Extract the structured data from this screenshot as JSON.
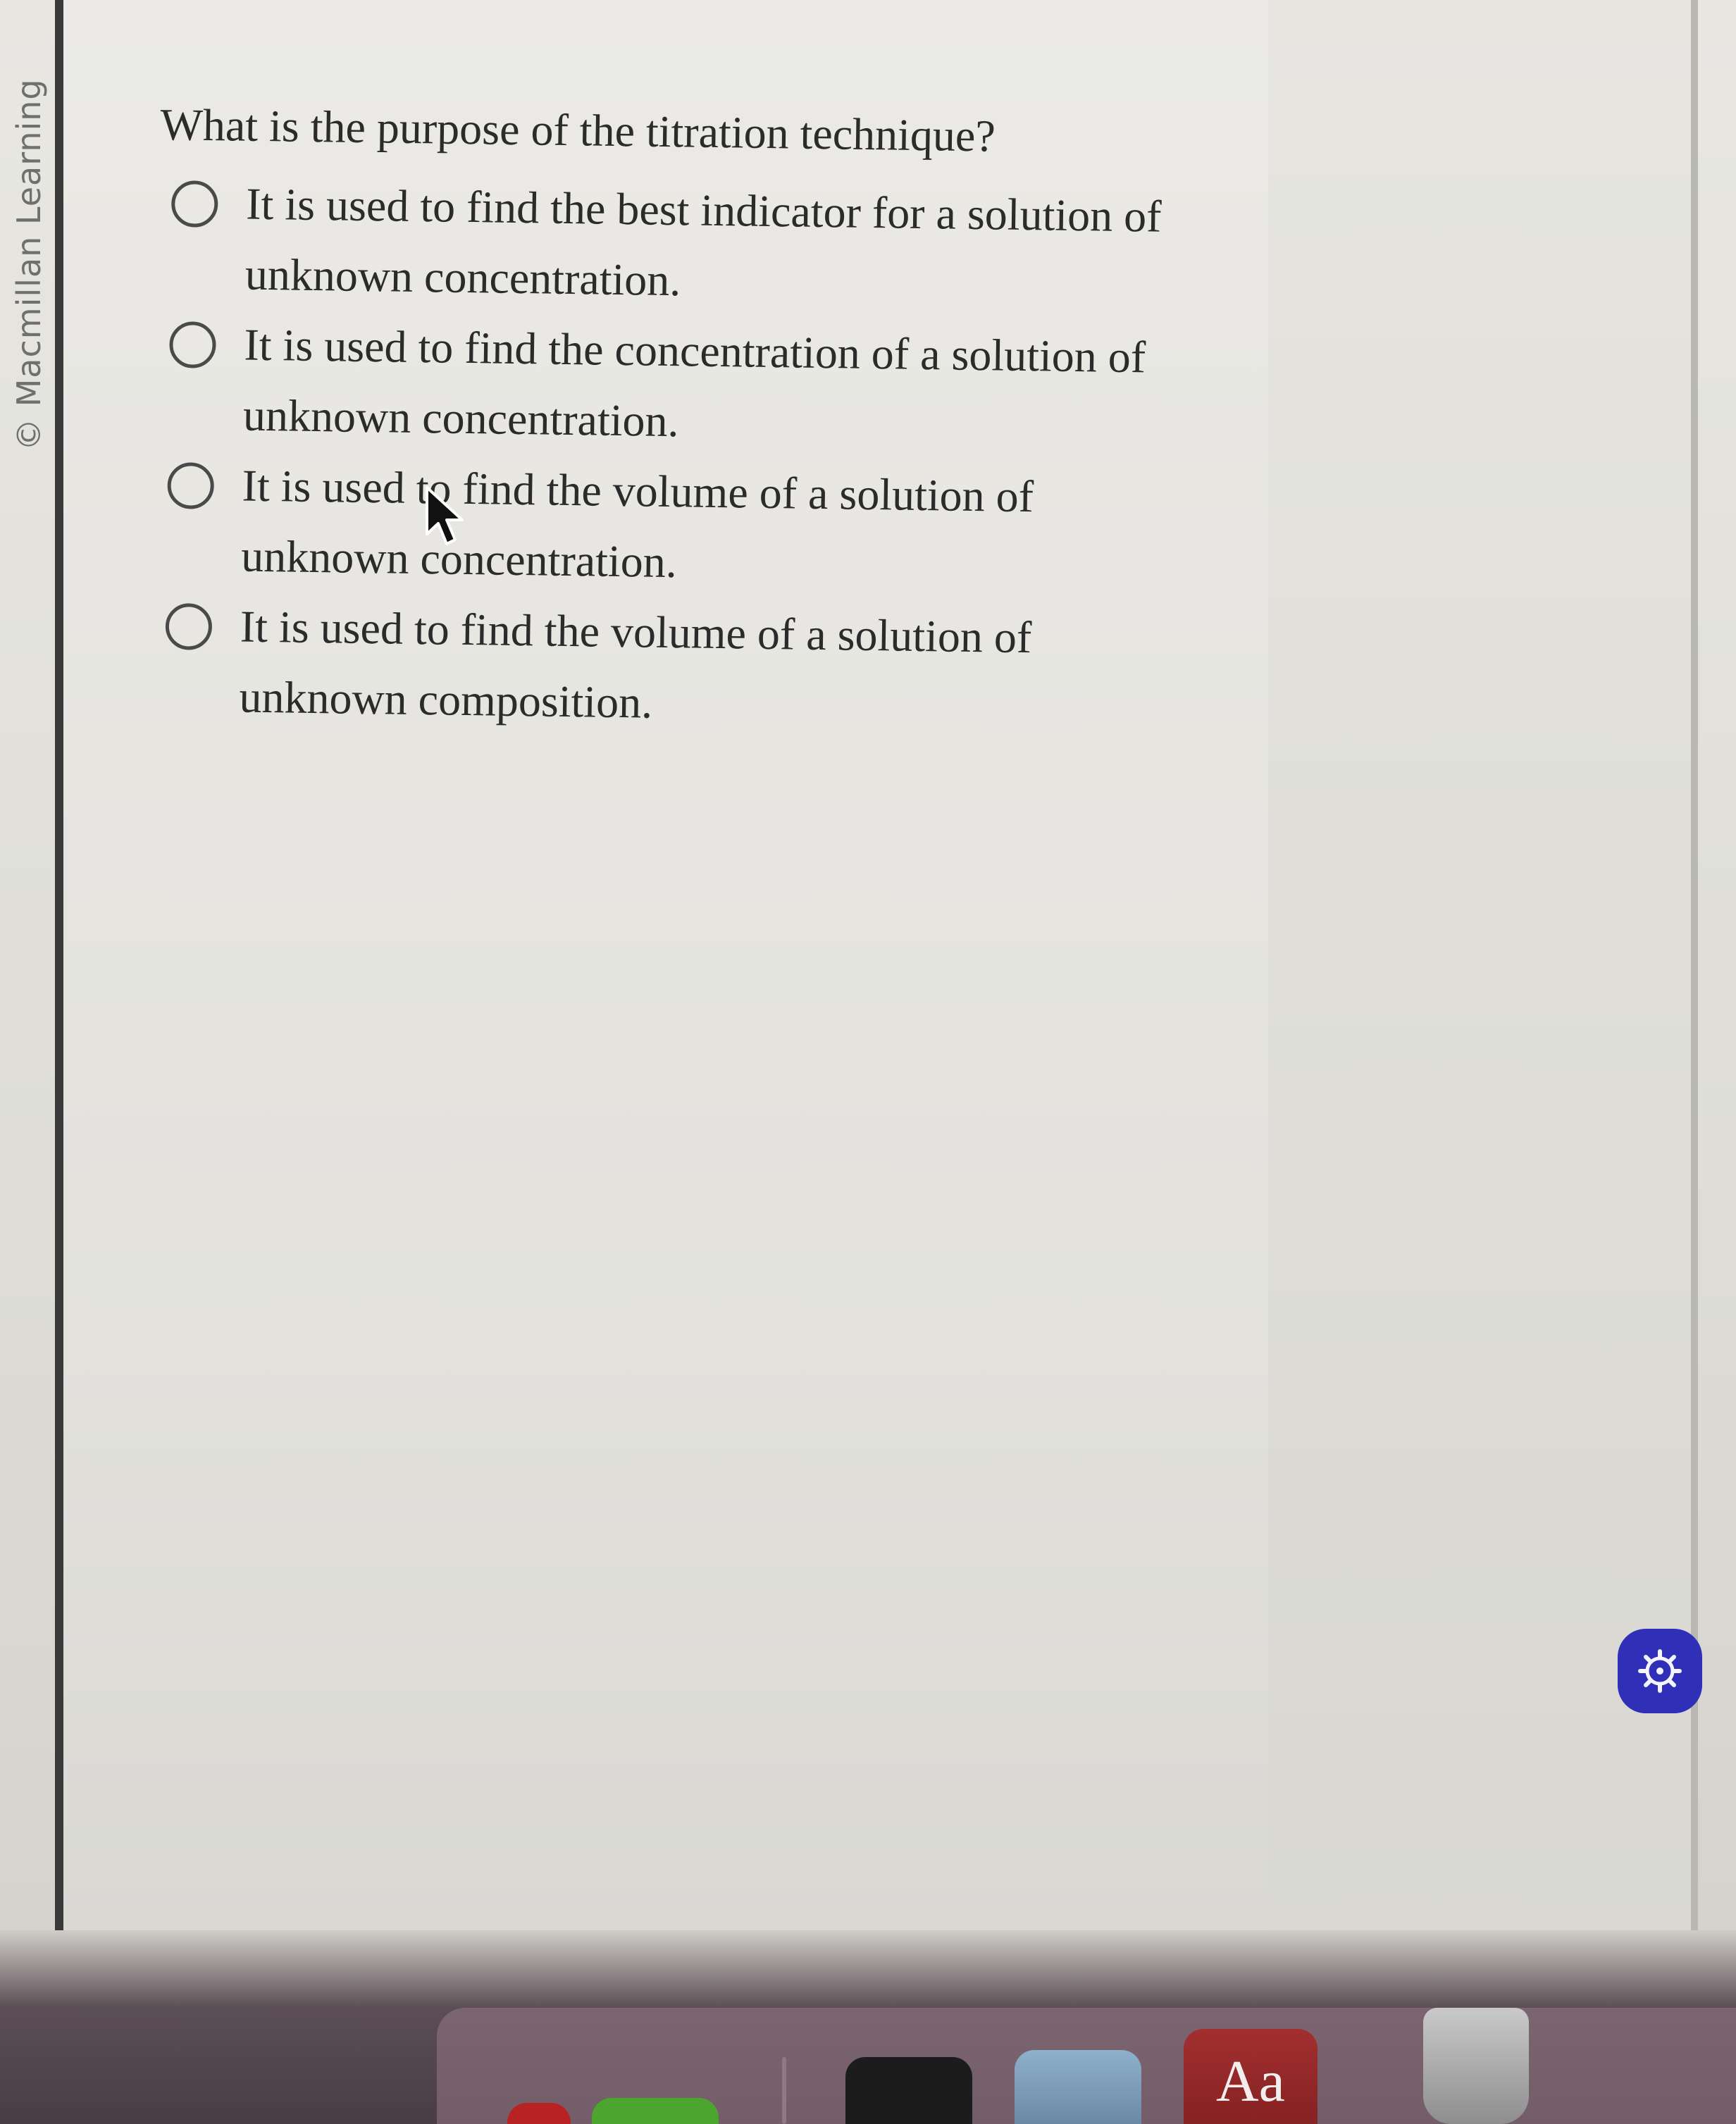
{
  "watermark": "© Macmillan Learning",
  "question": "What is the purpose of the titration technique?",
  "options": [
    {
      "text": "It is used to find the best indicator for a solution of unknown concentration."
    },
    {
      "text": "It is used to find the concentration of a solution of unknown concentration."
    },
    {
      "text": "It is used to find the volume of a solution of unknown concentration."
    },
    {
      "text": "It is used to find the volume of a solution of unknown composition."
    }
  ],
  "dock": {
    "dictionary_label": "Aa"
  },
  "icons": {
    "settings": "gear-icon",
    "cursor": "arrow-cursor-icon",
    "trash": "trash-icon"
  },
  "colors": {
    "settings_button": "#2f2fb8",
    "dictionary": "#a32f2f"
  }
}
